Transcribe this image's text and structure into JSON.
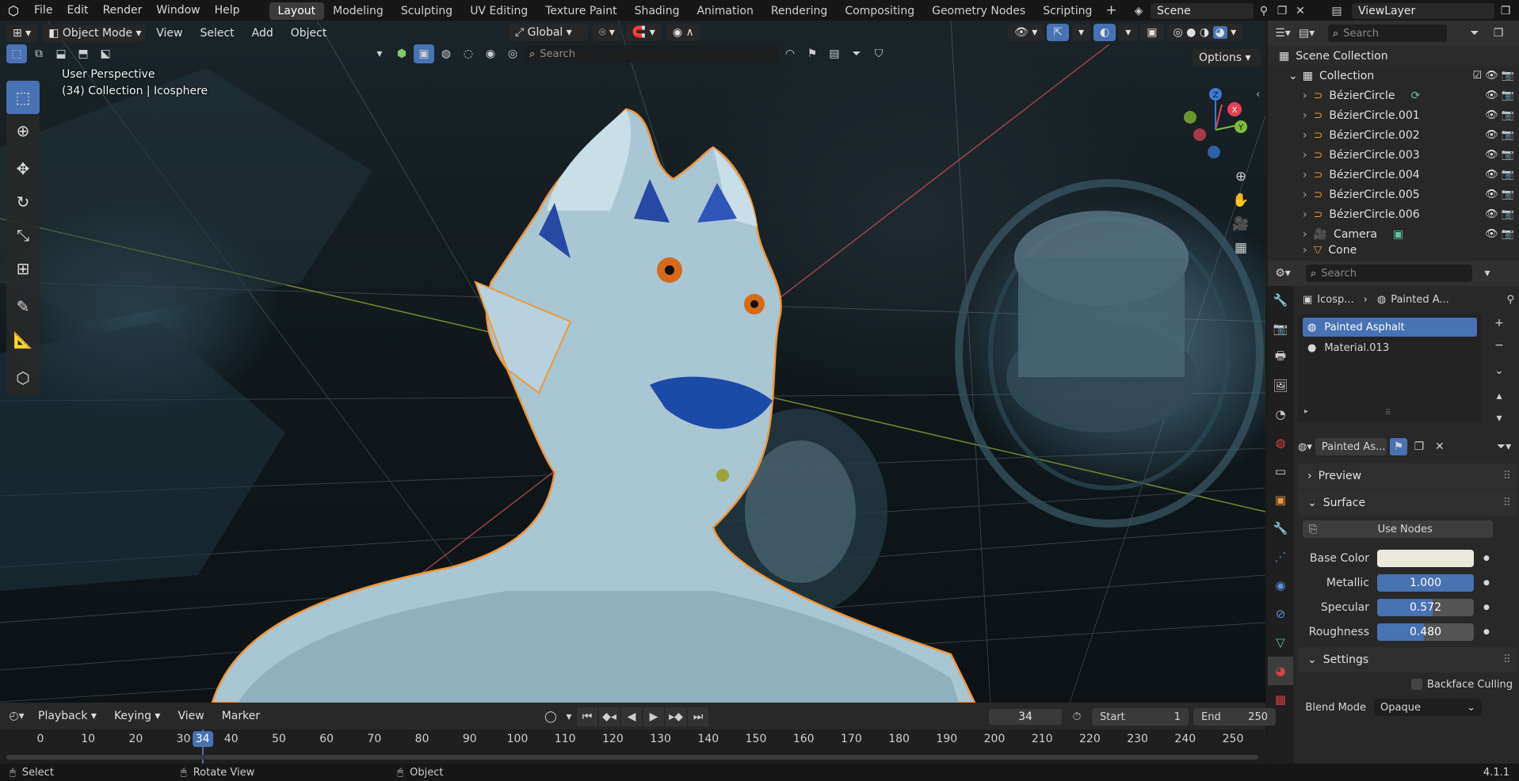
{
  "menubar": {
    "items": [
      "File",
      "Edit",
      "Render",
      "Window",
      "Help"
    ],
    "workspaces": [
      "Layout",
      "Modeling",
      "Sculpting",
      "UV Editing",
      "Texture Paint",
      "Shading",
      "Animation",
      "Rendering",
      "Compositing",
      "Geometry Nodes",
      "Scripting"
    ],
    "active_workspace": "Layout",
    "scene_name": "Scene",
    "view_layer": "ViewLayer"
  },
  "viewport": {
    "mode": "Object Mode",
    "menus": [
      "View",
      "Select",
      "Add",
      "Object"
    ],
    "transform_orientation": "Global",
    "search_placeholder": "Search",
    "options_label": "Options",
    "overlay_title": "User Perspective",
    "overlay_subtitle": "(34) Collection | Icosphere",
    "gizmo_axes": {
      "x": "X",
      "y": "Y",
      "z": "Z"
    }
  },
  "outliner": {
    "search_placeholder": "Search",
    "root": "Scene Collection",
    "collection": "Collection",
    "items": [
      {
        "name": "BézierCircle"
      },
      {
        "name": "BézierCircle.001"
      },
      {
        "name": "BézierCircle.002"
      },
      {
        "name": "BézierCircle.003"
      },
      {
        "name": "BézierCircle.004"
      },
      {
        "name": "BézierCircle.005"
      },
      {
        "name": "BézierCircle.006"
      },
      {
        "name": "Camera"
      },
      {
        "name": "Cone"
      }
    ]
  },
  "properties": {
    "search_placeholder": "Search",
    "breadcrumb_object": "Icosp...",
    "breadcrumb_material": "Painted A...",
    "material_slots": [
      "Painted Asphalt",
      "Material.013"
    ],
    "active_slot": "Painted Asphalt",
    "material_name": "Painted As...",
    "panels": {
      "preview": "Preview",
      "surface": "Surface",
      "settings": "Settings"
    },
    "use_nodes_label": "Use Nodes",
    "base_color_label": "Base Color",
    "base_color": "#ebe8dc",
    "metallic": {
      "label": "Metallic",
      "value": "1.000",
      "fraction": 1.0
    },
    "specular": {
      "label": "Specular",
      "value": "0.572",
      "fraction": 0.572
    },
    "roughness": {
      "label": "Roughness",
      "value": "0.480",
      "fraction": 0.48
    },
    "backface_culling_label": "Backface Culling",
    "blend_mode_label": "Blend Mode",
    "blend_mode_value": "Opaque"
  },
  "timeline": {
    "menus": [
      "Playback",
      "Keying",
      "View",
      "Marker"
    ],
    "current_frame": "34",
    "start_label": "Start",
    "start_value": "1",
    "end_label": "End",
    "end_value": "250",
    "ticks": [
      "0",
      "10",
      "20",
      "30",
      "40",
      "50",
      "60",
      "70",
      "80",
      "90",
      "100",
      "110",
      "120",
      "130",
      "140",
      "150",
      "160",
      "170",
      "180",
      "190",
      "200",
      "210",
      "220",
      "230",
      "240",
      "250"
    ]
  },
  "statusbar": {
    "select": "Select",
    "rotate": "Rotate View",
    "object": "Object",
    "version": "4.1.1"
  },
  "colors": {
    "accent": "#4772b3",
    "selection_outline": "#f0973a",
    "x_axis": "#e84057",
    "y_axis": "#7dbd3a",
    "z_axis": "#3b7ad6"
  }
}
